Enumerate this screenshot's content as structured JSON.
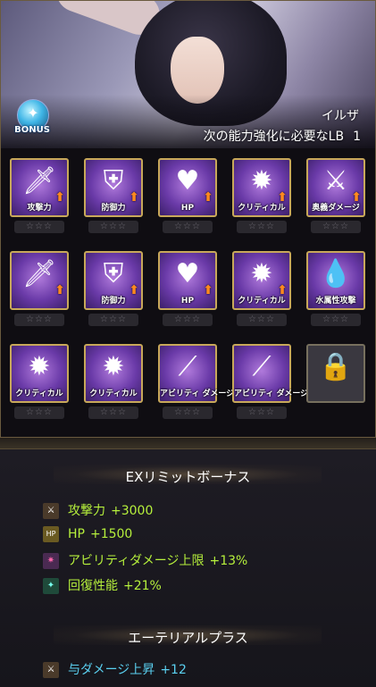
{
  "header": {
    "character_name": "イルザ",
    "lb_text": "次の能力強化に必要なLB",
    "lb_value": "1",
    "bonus_label": "BONUS"
  },
  "grid": {
    "rows": [
      [
        {
          "label": "攻撃力",
          "icon": "sword-icon",
          "glyph": "🗡",
          "up": true
        },
        {
          "label": "防御力",
          "icon": "shield-icon",
          "glyph": "⛨",
          "up": true
        },
        {
          "label": "HP",
          "icon": "heart-icon",
          "glyph": "♥",
          "up": true
        },
        {
          "label": "クリティカル",
          "icon": "burst-icon",
          "glyph": "✹",
          "up": true
        },
        {
          "label": "奥義ダメージ",
          "icon": "crossed-swords-icon",
          "glyph": "⚔",
          "up": true
        }
      ],
      [
        {
          "label": "",
          "icon": "sword-icon",
          "glyph": "🗡",
          "up": true
        },
        {
          "label": "防御力",
          "icon": "shield-icon",
          "glyph": "⛨",
          "up": true
        },
        {
          "label": "HP",
          "icon": "heart-icon",
          "glyph": "♥",
          "up": true
        },
        {
          "label": "クリティカル",
          "icon": "burst-icon",
          "glyph": "✹",
          "up": true
        },
        {
          "label": "水属性攻撃",
          "icon": "water-drop-icon",
          "glyph": "💧",
          "up": false
        }
      ],
      [
        {
          "label": "クリティカル",
          "icon": "burst-icon",
          "glyph": "✹",
          "up": false
        },
        {
          "label": "クリティカル",
          "icon": "burst-icon",
          "glyph": "✹",
          "up": false
        },
        {
          "label": "アビリティ ダメージ上限",
          "icon": "blades-icon",
          "glyph": "⟋",
          "up": false
        },
        {
          "label": "アビリティ ダメージ上限",
          "icon": "blades-icon",
          "glyph": "⟋",
          "up": false
        },
        {
          "label": "",
          "icon": "lock-icon",
          "glyph": "🔒",
          "up": false,
          "locked": true
        }
      ]
    ],
    "stars": "☆☆☆"
  },
  "ex_limit": {
    "title": "EXリミットボーナス",
    "items": [
      {
        "icon": "sword-icon",
        "label": "攻撃力",
        "value": "+3000"
      },
      {
        "icon": "hp-icon",
        "label": "HP",
        "value": "+1500"
      },
      {
        "icon": "sparkle-icon",
        "label": "アビリティダメージ上限",
        "value": "+13%"
      },
      {
        "icon": "heal-icon",
        "label": "回復性能",
        "value": "+21%"
      }
    ]
  },
  "aetherial": {
    "title": "エーテリアルプラス",
    "items": [
      {
        "icon": "sword-icon",
        "label": "与ダメージ上昇",
        "value": "+12"
      }
    ]
  }
}
